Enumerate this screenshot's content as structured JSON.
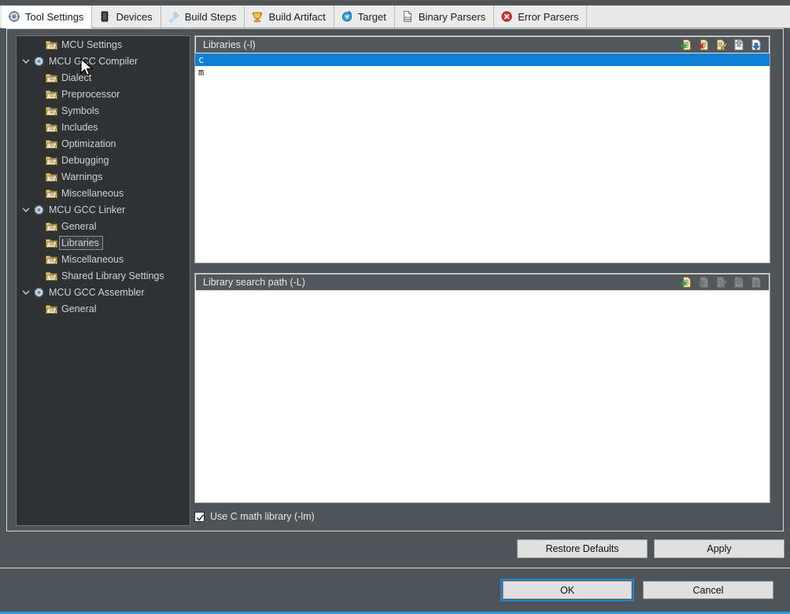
{
  "window": {
    "accent_focus_color": "#2e9bd6",
    "dialog_bg": "#4e5457",
    "tree_bg": "#2f3133",
    "list_bg": "#ffffff",
    "selection_color": "#0f7fd4"
  },
  "tabs": [
    {
      "label": "Tool Settings",
      "icon": "tool-settings-icon",
      "active": true
    },
    {
      "label": "Devices",
      "icon": "devices-chip-icon",
      "active": false
    },
    {
      "label": "Build Steps",
      "icon": "build-steps-icon",
      "active": false
    },
    {
      "label": "Build Artifact",
      "icon": "build-artifact-icon",
      "active": false
    },
    {
      "label": "Target",
      "icon": "target-icon",
      "active": false
    },
    {
      "label": "Binary Parsers",
      "icon": "binary-parsers-icon",
      "active": false
    },
    {
      "label": "Error Parsers",
      "icon": "error-parsers-icon",
      "active": false
    }
  ],
  "tree": [
    {
      "label": "MCU Settings",
      "level": 1,
      "twisty": "none",
      "icon": "folder-icon",
      "selected": false
    },
    {
      "label": "MCU GCC Compiler",
      "level": 0,
      "twisty": "expanded",
      "icon": "settings-icon",
      "selected": false
    },
    {
      "label": "Dialect",
      "level": 1,
      "twisty": "none",
      "icon": "folder-icon",
      "selected": false
    },
    {
      "label": "Preprocessor",
      "level": 1,
      "twisty": "none",
      "icon": "folder-icon",
      "selected": false
    },
    {
      "label": "Symbols",
      "level": 1,
      "twisty": "none",
      "icon": "folder-icon",
      "selected": false
    },
    {
      "label": "Includes",
      "level": 1,
      "twisty": "none",
      "icon": "folder-icon",
      "selected": false
    },
    {
      "label": "Optimization",
      "level": 1,
      "twisty": "none",
      "icon": "folder-icon",
      "selected": false
    },
    {
      "label": "Debugging",
      "level": 1,
      "twisty": "none",
      "icon": "folder-icon",
      "selected": false
    },
    {
      "label": "Warnings",
      "level": 1,
      "twisty": "none",
      "icon": "folder-icon",
      "selected": false
    },
    {
      "label": "Miscellaneous",
      "level": 1,
      "twisty": "none",
      "icon": "folder-icon",
      "selected": false
    },
    {
      "label": "MCU GCC Linker",
      "level": 0,
      "twisty": "expanded",
      "icon": "settings-icon",
      "selected": false
    },
    {
      "label": "General",
      "level": 1,
      "twisty": "none",
      "icon": "folder-icon",
      "selected": false
    },
    {
      "label": "Libraries",
      "level": 1,
      "twisty": "none",
      "icon": "folder-icon",
      "selected": true
    },
    {
      "label": "Miscellaneous",
      "level": 1,
      "twisty": "none",
      "icon": "folder-icon",
      "selected": false
    },
    {
      "label": "Shared Library Settings",
      "level": 1,
      "twisty": "none",
      "icon": "folder-icon",
      "selected": false
    },
    {
      "label": "MCU GCC Assembler",
      "level": 0,
      "twisty": "expanded",
      "icon": "settings-icon",
      "selected": false
    },
    {
      "label": "General",
      "level": 1,
      "twisty": "none",
      "icon": "folder-icon",
      "selected": false
    }
  ],
  "libraries_panel": {
    "title": "Libraries (-l)",
    "items": [
      {
        "value": "c",
        "selected": true
      },
      {
        "value": "m",
        "selected": false
      }
    ],
    "tools": [
      {
        "name": "add-icon",
        "enabled": true
      },
      {
        "name": "delete-icon",
        "enabled": true
      },
      {
        "name": "edit-icon",
        "enabled": true
      },
      {
        "name": "move-up-icon",
        "enabled": true
      },
      {
        "name": "move-down-icon",
        "enabled": true
      }
    ]
  },
  "search_path_panel": {
    "title": "Library search path (-L)",
    "items": [],
    "tools": [
      {
        "name": "add-icon",
        "enabled": true
      },
      {
        "name": "delete-icon",
        "enabled": false
      },
      {
        "name": "edit-icon",
        "enabled": false
      },
      {
        "name": "move-up-icon",
        "enabled": false
      },
      {
        "name": "move-down-icon",
        "enabled": false
      }
    ]
  },
  "math_library": {
    "label": "Use C math library (-lm)",
    "checked": true
  },
  "buttons": {
    "restore_defaults": "Restore Defaults",
    "apply": "Apply",
    "ok": "OK",
    "cancel": "Cancel"
  }
}
